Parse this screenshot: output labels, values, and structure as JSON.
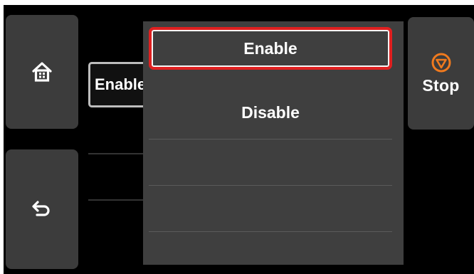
{
  "sidebar": {
    "home_icon": "home-icon",
    "back_icon": "back-arrow-icon"
  },
  "current_setting": {
    "value": "Enable"
  },
  "dropdown": {
    "options": [
      {
        "label": "Enable",
        "selected": true
      },
      {
        "label": "Disable",
        "selected": false
      },
      {
        "label": "",
        "selected": false
      },
      {
        "label": "",
        "selected": false
      },
      {
        "label": "",
        "selected": false
      }
    ]
  },
  "stop_button": {
    "label": "Stop",
    "icon": "stop-icon"
  },
  "colors": {
    "screen_bg": "#000000",
    "panel": "#3f3f3f",
    "button": "#3c3c3c",
    "selection_border": "#e02020",
    "stop_accent": "#f07a1e"
  }
}
